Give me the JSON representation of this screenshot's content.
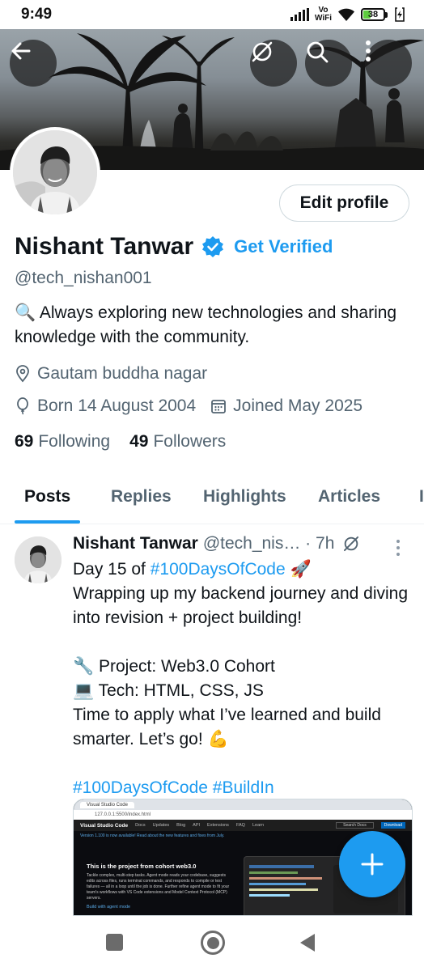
{
  "status_bar": {
    "time": "9:49",
    "network": "Vo WiFi",
    "battery": "38"
  },
  "header": {
    "back_icon": "arrow-left-icon",
    "hide_icon": "eye-off-icon",
    "search_icon": "search-icon",
    "more_icon": "more-vertical-icon"
  },
  "profile": {
    "edit_button": "Edit profile",
    "name": "Nishant Tanwar",
    "get_verified": "Get Verified",
    "handle": "@tech_nishan001",
    "bio": "🔍 Always exploring new technologies and sharing knowledge with the community.",
    "location": "Gautam buddha nagar",
    "birthday": "Born 14 August 2004",
    "joined": "Joined May 2025",
    "following_count": "69",
    "following_label": "Following",
    "followers_count": "49",
    "followers_label": "Followers"
  },
  "tabs": [
    {
      "label": "Posts",
      "active": true
    },
    {
      "label": "Replies",
      "active": false
    },
    {
      "label": "Highlights",
      "active": false
    },
    {
      "label": "Articles",
      "active": false
    }
  ],
  "post": {
    "author": "Nishant Tanwar",
    "handle_time": "@tech_nis… · 7h",
    "line1_prefix": "Day 15 of ",
    "line1_tag": "#100DaysOfCode",
    "line1_suffix": " 🚀",
    "line2": "Wrapping up my backend journey and diving into revision + project building!",
    "line3": "🔧 Project: Web3.0 Cohort",
    "line4": "💻 Tech: HTML, CSS, JS",
    "line5": "Time to apply what I’ve learned and build smarter. Let’s go! 💪",
    "tag1": "#100DaysOfCode",
    "tag2": "#BuildIn"
  },
  "media": {
    "tab_title": "Visual Studio Code",
    "url": "127.0.0.1:5500/index.html",
    "brand": "Visual Studio Code",
    "nav": [
      "Docs",
      "Updates",
      "Blog",
      "API",
      "Extensions",
      "FAQ",
      "Learn"
    ],
    "search_placeholder": "Search Docs",
    "download": "Download",
    "notice": "Version 1.100 is now available! Read about the new features and fixes from July.",
    "heading": "This is the project from cohort web3.0",
    "paragraph": "Tackle complex, multi-step tasks. Agent mode reads your codebase, suggests edits across files, runs terminal commands, and responds to compile or test failures — all in a loop until the job is done. Further refine agent mode to fit your team's workflows with VS Code extensions and Model Context Protocol (MCP) servers.",
    "link": "Build with agent mode"
  },
  "colors": {
    "accent": "#1d9bf0",
    "text": "#0f1419",
    "muted": "#536471"
  }
}
